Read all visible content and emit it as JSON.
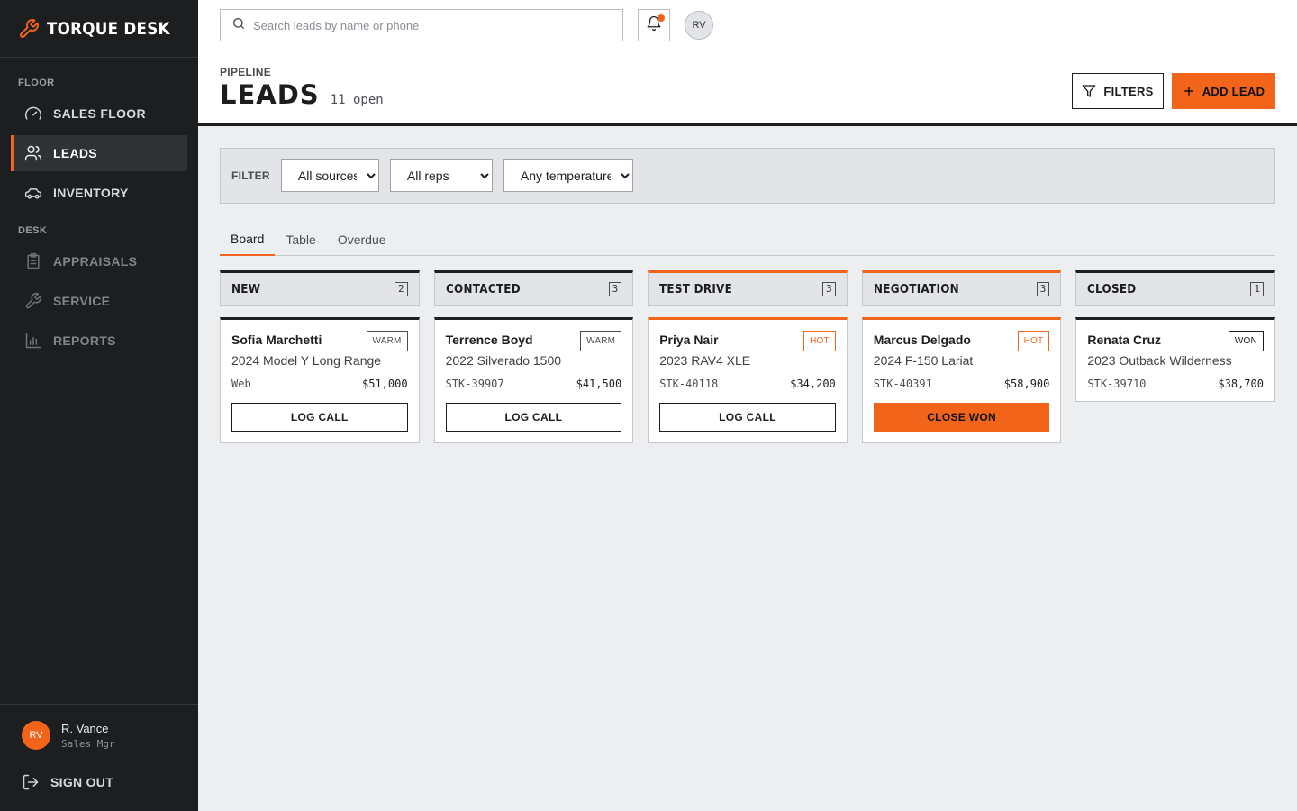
{
  "brand": {
    "name": "TORQUE DESK",
    "accent": "#f26419"
  },
  "sidebar": {
    "section_floor": "FLOOR",
    "section_desk": "DESK",
    "items": [
      {
        "label": "SALES FLOOR",
        "icon": "gauge-icon"
      },
      {
        "label": "LEADS",
        "icon": "users-icon",
        "active": true
      },
      {
        "label": "INVENTORY",
        "icon": "car-icon"
      },
      {
        "label": "APPRAISALS",
        "icon": "clipboard-icon"
      },
      {
        "label": "SERVICE",
        "icon": "wrench-icon"
      },
      {
        "label": "REPORTS",
        "icon": "bar-chart-icon"
      }
    ],
    "user": {
      "initials": "RV",
      "name": "R. Vance",
      "role": "Sales Mgr"
    },
    "signout": "SIGN OUT"
  },
  "topbar": {
    "search_placeholder": "Search leads by name or phone",
    "avatar_initials": "RV"
  },
  "header": {
    "eyebrow": "PIPELINE",
    "title": "LEADS",
    "open_count": "11 open",
    "filters_button": "FILTERS",
    "add_button": "ADD LEAD"
  },
  "filter_bar": {
    "label": "FILTER",
    "source": "All sources",
    "rep": "All reps",
    "temperature": "Any temperature"
  },
  "tabs": [
    {
      "label": "Board",
      "active": true
    },
    {
      "label": "Table"
    },
    {
      "label": "Overdue"
    }
  ],
  "columns": [
    {
      "title": "NEW",
      "count": "2",
      "cards": [
        {
          "name": "Sofia Marchetti",
          "badge": "WARM",
          "vehicle": "2024 Model Y Long Range",
          "source": "Web",
          "value": "$51,000",
          "action": "LOG CALL"
        }
      ]
    },
    {
      "title": "CONTACTED",
      "count": "3",
      "cards": [
        {
          "name": "Terrence Boyd",
          "badge": "WARM",
          "vehicle": "2022 Silverado 1500",
          "source": "STK-39907",
          "value": "$41,500",
          "action": "LOG CALL"
        }
      ]
    },
    {
      "title": "TEST DRIVE",
      "count": "3",
      "cards": [
        {
          "name": "Priya Nair",
          "badge": "HOT",
          "vehicle": "2023 RAV4 XLE",
          "source": "STK-40118",
          "value": "$34,200",
          "action": "LOG CALL"
        }
      ]
    },
    {
      "title": "NEGOTIATION",
      "count": "3",
      "cards": [
        {
          "name": "Marcus Delgado",
          "badge": "HOT",
          "vehicle": "2024 F-150 Lariat",
          "source": "STK-40391",
          "value": "$58,900",
          "action": "CLOSE WON"
        }
      ]
    },
    {
      "title": "CLOSED",
      "count": "1",
      "cards": [
        {
          "name": "Renata Cruz",
          "badge": "WON",
          "vehicle": "2023 Outback Wilderness",
          "source": "STK-39710",
          "value": "$38,700"
        }
      ]
    }
  ]
}
